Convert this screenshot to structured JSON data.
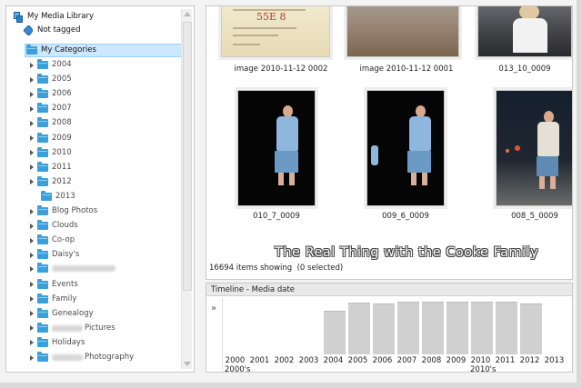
{
  "tree": {
    "root_label": "My Media Library",
    "not_tagged_label": "Not tagged",
    "categories_label": "My Categories",
    "items": [
      {
        "label": "2004",
        "expandable": true
      },
      {
        "label": "2005",
        "expandable": true
      },
      {
        "label": "2006",
        "expandable": true
      },
      {
        "label": "2007",
        "expandable": true
      },
      {
        "label": "2008",
        "expandable": true
      },
      {
        "label": "2009",
        "expandable": true
      },
      {
        "label": "2010",
        "expandable": true
      },
      {
        "label": "2011",
        "expandable": true
      },
      {
        "label": "2012",
        "expandable": true
      },
      {
        "label": "2013",
        "expandable": false
      },
      {
        "label": "Blog Photos",
        "expandable": true
      },
      {
        "label": "Clouds",
        "expandable": true
      },
      {
        "label": "Co-op",
        "expandable": true
      },
      {
        "label": "Daisy's",
        "expandable": true
      },
      {
        "label": "",
        "expandable": true,
        "redacted": true
      },
      {
        "label": "Events",
        "expandable": true
      },
      {
        "label": "Family",
        "expandable": true
      },
      {
        "label": "Genealogy",
        "expandable": true
      },
      {
        "label": "Pictures",
        "expandable": true,
        "redacted_prefix": true
      },
      {
        "label": "Holidays",
        "expandable": true
      },
      {
        "label": "Photography",
        "expandable": true,
        "redacted_prefix": true
      }
    ]
  },
  "thumbnails": [
    {
      "caption": "image 2010-11-12 0002",
      "doc_text": "55E 8"
    },
    {
      "caption": "image 2010-11-12 0001"
    },
    {
      "caption": "013_10_0009"
    },
    {
      "caption": "010_7_0009"
    },
    {
      "caption": "009_6_0009"
    },
    {
      "caption": "008_5_0009"
    }
  ],
  "status": {
    "items_showing": "16694 items showing",
    "selected": "(0 selected)"
  },
  "watermark": "The Real Thing with the Cooke Family",
  "timeline": {
    "header": "Timeline - Media date",
    "expand_glyph": "»",
    "years": [
      "2000",
      "2001",
      "2002",
      "2003",
      "2004",
      "2005",
      "2006",
      "2007",
      "2008",
      "2009",
      "2010",
      "2011",
      "2012",
      "2013"
    ],
    "bar_levels": [
      0,
      0,
      0,
      0,
      0.82,
      0.98,
      0.96,
      1.0,
      1.0,
      1.0,
      1.0,
      1.0,
      0.96,
      0
    ],
    "decades": [
      "2000's",
      "2010's"
    ]
  }
}
